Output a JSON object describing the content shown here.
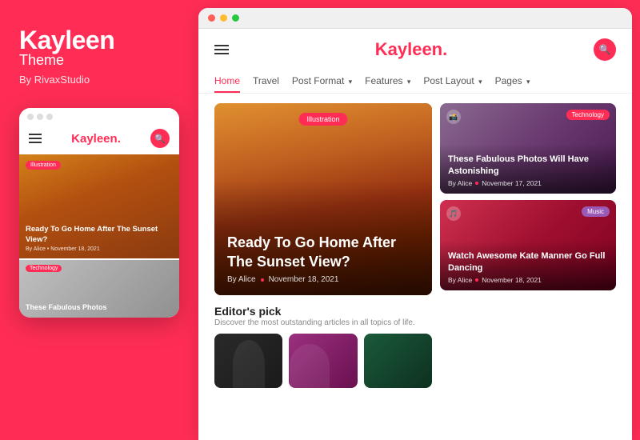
{
  "left": {
    "brand_name": "Kayleen",
    "brand_theme": "Theme",
    "brand_by": "By RivaxStudio",
    "mock_dots": [
      "dot1",
      "dot2",
      "dot3"
    ],
    "mock_brand": "Kayleen",
    "mock_brand_dot": ".",
    "mock_hero_badge": "Illustration",
    "mock_hero_title": "Ready To Go Home After The Sunset View?",
    "mock_hero_meta": "By Alice  •  November 18, 2021",
    "mock_card2_badge": "Technology",
    "mock_card2_title": "These Fabulous Photos"
  },
  "browser": {
    "site_logo": "Kayleen",
    "site_logo_dot": ".",
    "nav": {
      "items": [
        {
          "label": "Home",
          "active": true,
          "arrow": false
        },
        {
          "label": "Travel",
          "active": false,
          "arrow": false
        },
        {
          "label": "Post Format",
          "active": false,
          "arrow": true
        },
        {
          "label": "Features",
          "active": false,
          "arrow": true
        },
        {
          "label": "Post Layout",
          "active": false,
          "arrow": true
        },
        {
          "label": "Pages",
          "active": false,
          "arrow": true
        }
      ]
    },
    "hero": {
      "badge": "Illustration",
      "title": "Ready To Go Home After The Sunset View?",
      "meta_author": "By Alice",
      "meta_date": "November 18, 2021"
    },
    "side_cards": [
      {
        "badge": "Technology",
        "badge_type": "tech",
        "title": "These Fabulous Photos Will Have Astonishing",
        "author": "By Alice",
        "date": "November 17, 2021"
      },
      {
        "badge": "Music",
        "badge_type": "music",
        "title": "Watch Awesome Kate Manner Go Full Dancing",
        "author": "By Alice",
        "date": "November 18, 2021"
      }
    ],
    "editors": {
      "title": "Editor's pick",
      "subtitle": "Discover the most outstanding articles in all topics of life."
    }
  }
}
